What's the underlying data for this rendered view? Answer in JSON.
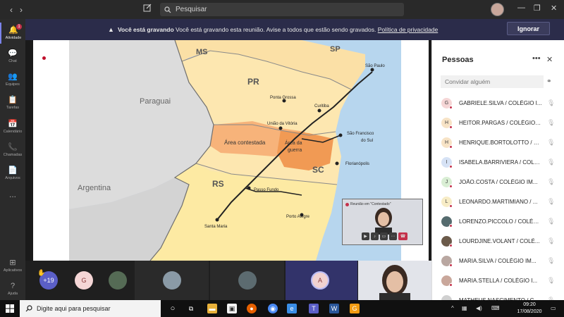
{
  "titlebar": {
    "search_placeholder": "Pesquisar",
    "back": "‹",
    "forward": "›",
    "minimize": "—",
    "maximize": "❐",
    "close": "✕"
  },
  "rail": {
    "items": [
      {
        "label": "Atividade",
        "icon": "🔔",
        "badge": "1"
      },
      {
        "label": "Chat",
        "icon": "💬"
      },
      {
        "label": "Equipes",
        "icon": "👥"
      },
      {
        "label": "Tarefas",
        "icon": "📋"
      },
      {
        "label": "Calendário",
        "icon": "📅"
      },
      {
        "label": "Chamadas",
        "icon": "📞"
      },
      {
        "label": "Arquivos",
        "icon": "📄"
      },
      {
        "label": "...",
        "icon": ""
      }
    ],
    "bottom": [
      {
        "label": "Aplicativos",
        "icon": "⊞"
      },
      {
        "label": "Ajuda",
        "icon": "?"
      }
    ]
  },
  "banner": {
    "bold": "Você está gravando",
    "text": " Você está gravando esta reunião. Avise a todos que estão sendo gravados. ",
    "link": "Política de privacidade",
    "dismiss": "Ignorar"
  },
  "map": {
    "labels": {
      "ms": "MS",
      "sp": "SP",
      "pr": "PR",
      "sc": "SC",
      "rs": "RS",
      "paraguai": "Paraguai",
      "argentina": "Argentina",
      "sao_paulo": "São Paulo",
      "ponta_grossa": "Ponta Grossa",
      "curitiba": "Curitiba",
      "uniao_vitoria": "União da Vitória",
      "sao_francisco": "São Francisco",
      "do_sul": "do Sul",
      "florianopolis": "Florianópolis",
      "passo_fundo": "Passo Fundo",
      "porto_alegre": "Porto Alegre",
      "santa_maria": "Santa Maria",
      "area_contestada": "Área contestada",
      "area_da": "Área da",
      "guerra": "guerra"
    }
  },
  "mini": {
    "rec_label": "Reunião em \"Contestado\""
  },
  "people": {
    "title": "Pessoas",
    "more": "•••",
    "close": "✕",
    "invite_placeholder": "Convidar alguém",
    "list": [
      {
        "initial": "G",
        "name": "GABRIELE.SILVA / COLÉGIO I...",
        "color": "#f5d6d6"
      },
      {
        "initial": "H",
        "name": "HEITOR.PARGAS / COLÉGIO I...",
        "color": "#f7e3c6"
      },
      {
        "initial": "H",
        "name": "HENRIQUE.BORTOLOTTO / C...",
        "color": "#f7e3c6"
      },
      {
        "initial": "I",
        "name": "ISABELA.BARRIVIERA / COLÉ...",
        "color": "#d6e2f5"
      },
      {
        "initial": "J",
        "name": "JOÃO.COSTA / COLÉGIO IM...",
        "color": "#d9eed4"
      },
      {
        "initial": "L",
        "name": "LEONARDO.MARTIMIANO / ...",
        "color": "#f7ecc6"
      },
      {
        "initial": "",
        "name": "LORENZO.PICCOLO / COLÉG...",
        "color": "#556b6e"
      },
      {
        "initial": "",
        "name": "LOURDJINE.VOLANT / COLÉ...",
        "color": "#6b5a4a"
      },
      {
        "initial": "",
        "name": "MARIA.SILVA / COLÉGIO IM...",
        "color": "#b9a7a1"
      },
      {
        "initial": "",
        "name": "MARIA.STELLA / COLÉGIO I...",
        "color": "#c9a79b"
      },
      {
        "initial": "",
        "name": "MATHEUS.NASCIMENTO / C...",
        "color": "#d0d0d0"
      }
    ]
  },
  "strip": {
    "overflow": "+19",
    "g": "G",
    "a": "A"
  },
  "taskbar": {
    "search_placeholder": "Digite aqui para pesquisar",
    "time": "09:20",
    "date": "17/08/2020"
  },
  "colors": {
    "accent": "#7b83eb",
    "recording": "#c4314b",
    "banner": "#2b2c4a"
  }
}
